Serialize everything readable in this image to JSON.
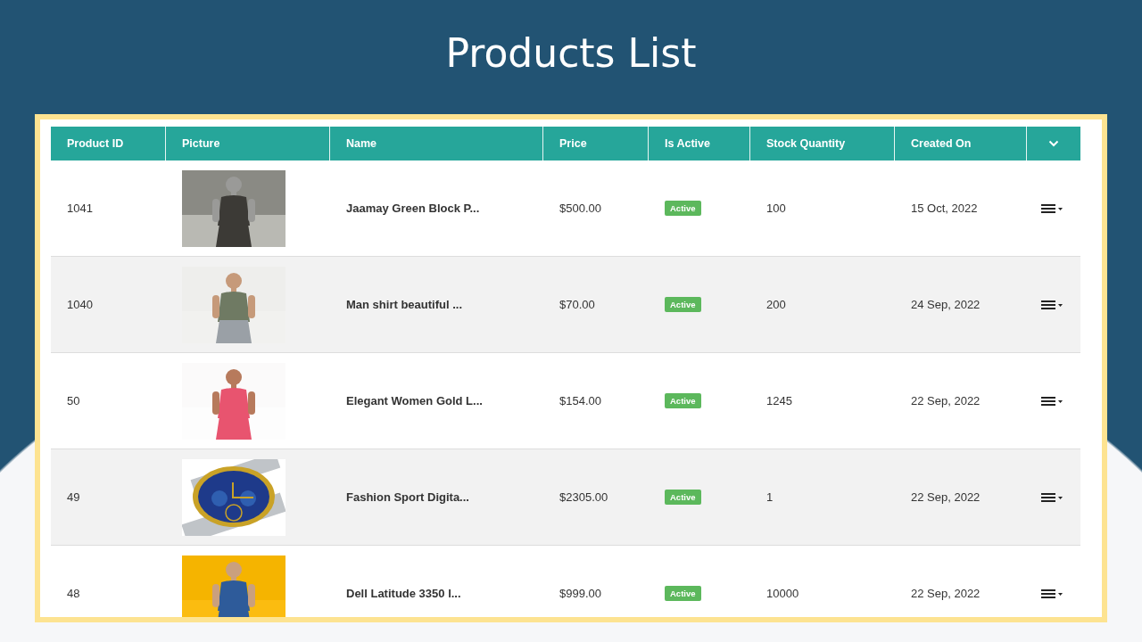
{
  "title": "Products List",
  "table": {
    "columns": [
      "Product ID",
      "Picture",
      "Name",
      "Price",
      "Is Active",
      "Stock Quantity",
      "Created On"
    ],
    "rows": [
      {
        "id": "1041",
        "name": "Jaamay Green Block P...",
        "price": "$500.00",
        "status": "Active",
        "stock": "100",
        "created": "15 Oct, 2022"
      },
      {
        "id": "1040",
        "name": "Man shirt beautiful ...",
        "price": "$70.00",
        "status": "Active",
        "stock": "200",
        "created": "24 Sep, 2022"
      },
      {
        "id": "50",
        "name": "Elegant Women Gold L...",
        "price": "$154.00",
        "status": "Active",
        "stock": "1245",
        "created": "22 Sep, 2022"
      },
      {
        "id": "49",
        "name": "Fashion Sport Digita...",
        "price": "$2305.00",
        "status": "Active",
        "stock": "1",
        "created": "22 Sep, 2022"
      },
      {
        "id": "48",
        "name": "Dell Latitude 3350 l...",
        "price": "$999.00",
        "status": "Active",
        "stock": "10000",
        "created": "22 Sep, 2022"
      }
    ]
  }
}
